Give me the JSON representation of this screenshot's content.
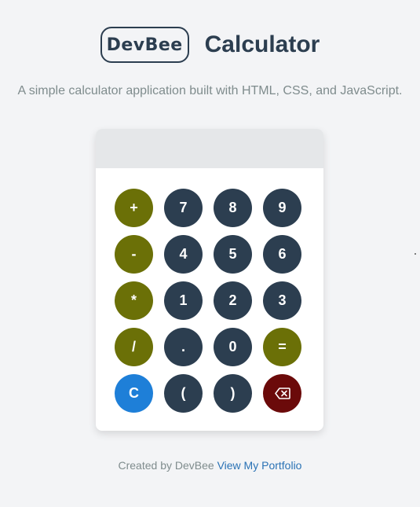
{
  "header": {
    "logo_text": "DevBee",
    "title": "Calculator"
  },
  "subtitle": "A simple calculator application built with HTML, CSS, and JavaScript.",
  "calculator": {
    "display_value": "",
    "buttons": [
      {
        "label": "+",
        "kind": "op",
        "name": "plus-button"
      },
      {
        "label": "7",
        "kind": "num",
        "name": "seven-button"
      },
      {
        "label": "8",
        "kind": "num",
        "name": "eight-button"
      },
      {
        "label": "9",
        "kind": "num",
        "name": "nine-button"
      },
      {
        "label": "-",
        "kind": "op",
        "name": "minus-button"
      },
      {
        "label": "4",
        "kind": "num",
        "name": "four-button"
      },
      {
        "label": "5",
        "kind": "num",
        "name": "five-button"
      },
      {
        "label": "6",
        "kind": "num",
        "name": "six-button"
      },
      {
        "label": "*",
        "kind": "op",
        "name": "multiply-button"
      },
      {
        "label": "1",
        "kind": "num",
        "name": "one-button"
      },
      {
        "label": "2",
        "kind": "num",
        "name": "two-button"
      },
      {
        "label": "3",
        "kind": "num",
        "name": "three-button"
      },
      {
        "label": "/",
        "kind": "op",
        "name": "divide-button"
      },
      {
        "label": ".",
        "kind": "num",
        "name": "decimal-button"
      },
      {
        "label": "0",
        "kind": "num",
        "name": "zero-button"
      },
      {
        "label": "=",
        "kind": "op",
        "name": "equals-button"
      },
      {
        "label": "C",
        "kind": "clear",
        "name": "clear-button"
      },
      {
        "label": "(",
        "kind": "num",
        "name": "open-paren-button"
      },
      {
        "label": ")",
        "kind": "num",
        "name": "close-paren-button"
      },
      {
        "label": "",
        "kind": "back",
        "name": "backspace-button",
        "icon": "backspace-icon"
      }
    ]
  },
  "footer": {
    "prefix": "Created by DevBee",
    "link_text": "View My Portfolio"
  },
  "colors": {
    "number_button": "#2c3e50",
    "operator_button": "#6b7007",
    "clear_button": "#1e7fd8",
    "backspace_button": "#6b0a0a",
    "link": "#2a72b5"
  }
}
